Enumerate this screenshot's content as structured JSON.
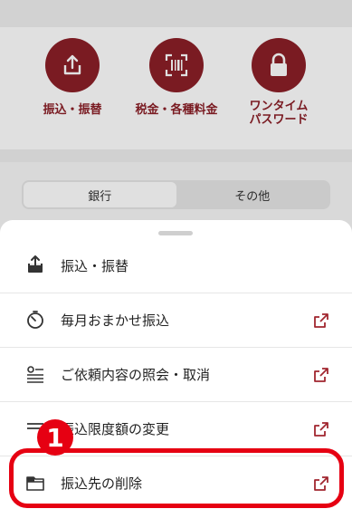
{
  "background": {
    "quick_actions": [
      {
        "label_line1": "振込・振替",
        "label_line2": "",
        "icon": "share-upload-icon"
      },
      {
        "label_line1": "税金・各種料金",
        "label_line2": "",
        "icon": "barcode-scan-icon"
      },
      {
        "label_line1": "ワンタイム",
        "label_line2": "パスワード",
        "icon": "lock-icon"
      }
    ],
    "segmented": {
      "left": "銀行",
      "right": "その他",
      "active": "left"
    }
  },
  "sheet": {
    "items": [
      {
        "label": "振込・振替",
        "icon": "upload-icon",
        "external": false
      },
      {
        "label": "毎月おまかせ振込",
        "icon": "timer-icon",
        "external": true
      },
      {
        "label": "ご依頼内容の照会・取消",
        "icon": "list-search-icon",
        "external": true
      },
      {
        "label": "振込限度額の変更",
        "icon": "limit-change-icon",
        "external": true
      },
      {
        "label": "振込先の削除",
        "icon": "folder-delete-icon",
        "external": true
      }
    ]
  },
  "annotation": {
    "badge": "1",
    "color": "#e60012"
  },
  "colors": {
    "brand": "#8b1f27",
    "accent_red": "#e60012",
    "external_link": "#a1262f"
  }
}
